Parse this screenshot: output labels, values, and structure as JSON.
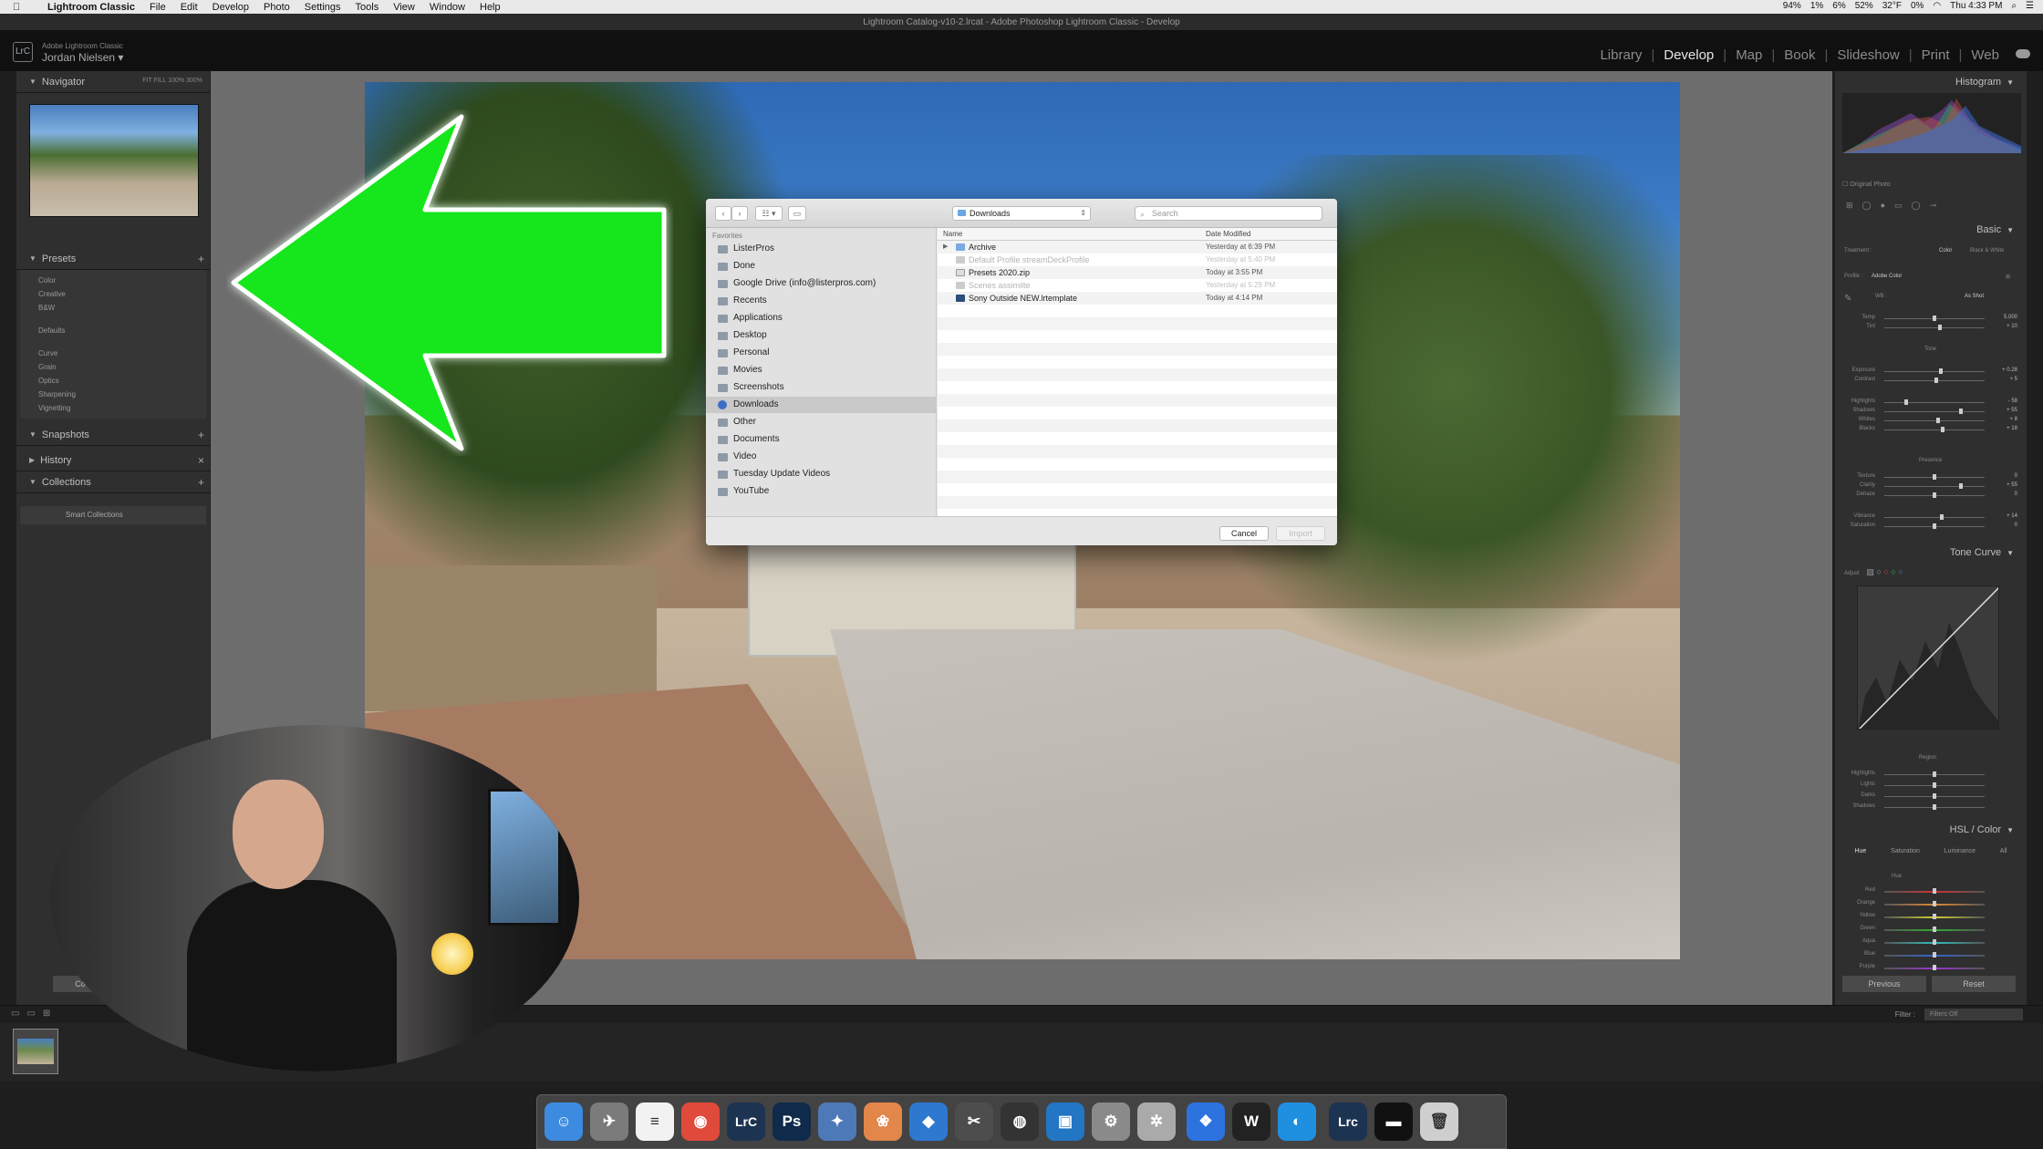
{
  "menubar": {
    "app_name": "Lightroom Classic",
    "items": [
      "File",
      "Edit",
      "Develop",
      "Photo",
      "Settings",
      "Tools",
      "View",
      "Window",
      "Help"
    ],
    "status": [
      "94%",
      "1%",
      "6%",
      "52%",
      "32°F",
      "0%"
    ],
    "clock": "Thu 4:33 PM"
  },
  "window": {
    "title": "Lightroom Catalog-v10-2.lrcat - Adobe Photoshop Lightroom Classic - Develop"
  },
  "identity": {
    "badge": "LrC",
    "product": "Adobe Lightroom Classic",
    "user": "Jordan Nielsen ▾"
  },
  "modules": {
    "items": [
      "Library",
      "Develop",
      "Map",
      "Book",
      "Slideshow",
      "Print",
      "Web"
    ],
    "active": "Develop"
  },
  "left_panel": {
    "navigator": {
      "title": "Navigator",
      "zoom": "FIT  FILL  100%  300%"
    },
    "presets": {
      "title": "Presets",
      "group1": [
        "Color",
        "Creative",
        "B&W"
      ],
      "group2": [
        "Defaults"
      ],
      "group3": [
        "Curve",
        "Grain",
        "Optics",
        "Sharpening",
        "Vignetting"
      ]
    },
    "snapshots": "Snapshots",
    "history": "History",
    "collections": "Collections",
    "smart_collections": "Smart Collections",
    "bottom_button": "Co"
  },
  "file_dialog": {
    "location": "Downloads",
    "search_placeholder": "Search",
    "favorites_label": "Favorites",
    "sidebar": [
      "ListerPros",
      "Done",
      "Google Drive (info@listerpros.com)",
      "Recents",
      "Applications",
      "Desktop",
      "Personal",
      "Movies",
      "Screenshots",
      "Downloads",
      "Other",
      "Documents",
      "Video",
      "Tuesday Update Videos",
      "YouTube"
    ],
    "selected": "Downloads",
    "columns": {
      "name": "Name",
      "date": "Date Modified"
    },
    "files": [
      {
        "name": "Archive",
        "date": "Yesterday at 6:39 PM",
        "dim": false
      },
      {
        "name": "Default Profile streamDeckProfile",
        "date": "Yesterday at 5:40 PM",
        "dim": true
      },
      {
        "name": "Presets 2020.zip",
        "date": "Today at 3:55 PM",
        "dim": false
      },
      {
        "name": "Scenes assimilte",
        "date": "Yesterday at 5:29 PM",
        "dim": true
      },
      {
        "name": "Sony Outside NEW.lrtemplate",
        "date": "Today at 4:14 PM",
        "dim": false
      }
    ],
    "cancel": "Cancel",
    "import": "Import"
  },
  "right_panel": {
    "histogram": "Histogram",
    "original_photo": "Original Photo",
    "basic": "Basic",
    "treatment_label": "Treatment :",
    "treatment_color": "Color",
    "treatment_bw": "Black & White",
    "profile_label": "Profile :",
    "profile_value": "Adobe Color",
    "wb_label": "WB :",
    "wb_value": "As Shot",
    "tone_label": "Tone",
    "presence_label": "Presence",
    "sliders": [
      {
        "label": "Temp",
        "value": "5,000",
        "pos": 0.5
      },
      {
        "label": "Tint",
        "value": "+ 10",
        "pos": 0.55
      },
      {
        "label": "Exposure",
        "value": "+ 0.28",
        "pos": 0.56
      },
      {
        "label": "Contrast",
        "value": "+ 5",
        "pos": 0.52
      },
      {
        "label": "Highlights",
        "value": "- 58",
        "pos": 0.22
      },
      {
        "label": "Shadows",
        "value": "+ 55",
        "pos": 0.76
      },
      {
        "label": "Whites",
        "value": "+ 8",
        "pos": 0.54
      },
      {
        "label": "Blacks",
        "value": "+ 18",
        "pos": 0.58
      },
      {
        "label": "Texture",
        "value": "0",
        "pos": 0.5
      },
      {
        "label": "Clarity",
        "value": "+ 55",
        "pos": 0.76
      },
      {
        "label": "Dehaze",
        "value": "0",
        "pos": 0.5
      },
      {
        "label": "Vibrance",
        "value": "+ 14",
        "pos": 0.57
      },
      {
        "label": "Saturation",
        "value": "0",
        "pos": 0.5
      }
    ],
    "tone_curve": "Tone Curve",
    "adjust_label": "Adjust",
    "region_label": "Region",
    "region_sliders": [
      "Highlights",
      "Lights",
      "Darks",
      "Shadows"
    ],
    "hsl": "HSL / Color",
    "hsl_tabs": [
      "Hue",
      "Saturation",
      "Luminance",
      "All"
    ],
    "hue_label": "Hue",
    "hue_sliders": [
      "Red",
      "Orange",
      "Yellow",
      "Green",
      "Aqua",
      "Blue",
      "Purple"
    ],
    "previous": "Previous",
    "reset": "Reset"
  },
  "filmstrip": {
    "filter_label": "Filter :",
    "filter_value": "Filters Off"
  },
  "dock": {
    "icons": [
      {
        "name": "finder",
        "glyph": "☺",
        "color": "#3c8be0"
      },
      {
        "name": "launchpad",
        "glyph": "✈",
        "color": "#7b7b7b"
      },
      {
        "name": "notes",
        "glyph": "≡",
        "color": "#f2f2f2"
      },
      {
        "name": "chrome",
        "glyph": "◉",
        "color": "#e04a3a"
      },
      {
        "name": "lightroom-classic",
        "glyph": "LrC",
        "color": "#1d3352"
      },
      {
        "name": "photoshop",
        "glyph": "Ps",
        "color": "#0f2a4a"
      },
      {
        "name": "safari",
        "glyph": "✦",
        "color": "#4e79b8"
      },
      {
        "name": "photos",
        "glyph": "❀",
        "color": "#e2864a"
      },
      {
        "name": "box-app",
        "glyph": "◆",
        "color": "#2e78d0"
      },
      {
        "name": "final-cut",
        "glyph": "✂",
        "color": "#4d4d4d"
      },
      {
        "name": "davinci-resolve",
        "glyph": "◍",
        "color": "#333"
      },
      {
        "name": "live-app",
        "glyph": "▣",
        "color": "#2276c4"
      },
      {
        "name": "system-preferences",
        "glyph": "⚙",
        "color": "#8a8a8a"
      },
      {
        "name": "compressor",
        "glyph": "✲",
        "color": "#aaa"
      },
      {
        "name": "dropbox",
        "glyph": "❖",
        "color": "#2c73e0"
      },
      {
        "name": "wordpress",
        "glyph": "W",
        "color": "#222"
      },
      {
        "name": "camo-app",
        "glyph": "◐",
        "color": "#1f8fe0"
      },
      {
        "name": "lrc-preset",
        "glyph": "Lrc",
        "color": "#1d3352"
      },
      {
        "name": "terminal",
        "glyph": "▬",
        "color": "#111"
      },
      {
        "name": "trash",
        "glyph": "🗑",
        "color": "#cfcfcf"
      }
    ]
  }
}
